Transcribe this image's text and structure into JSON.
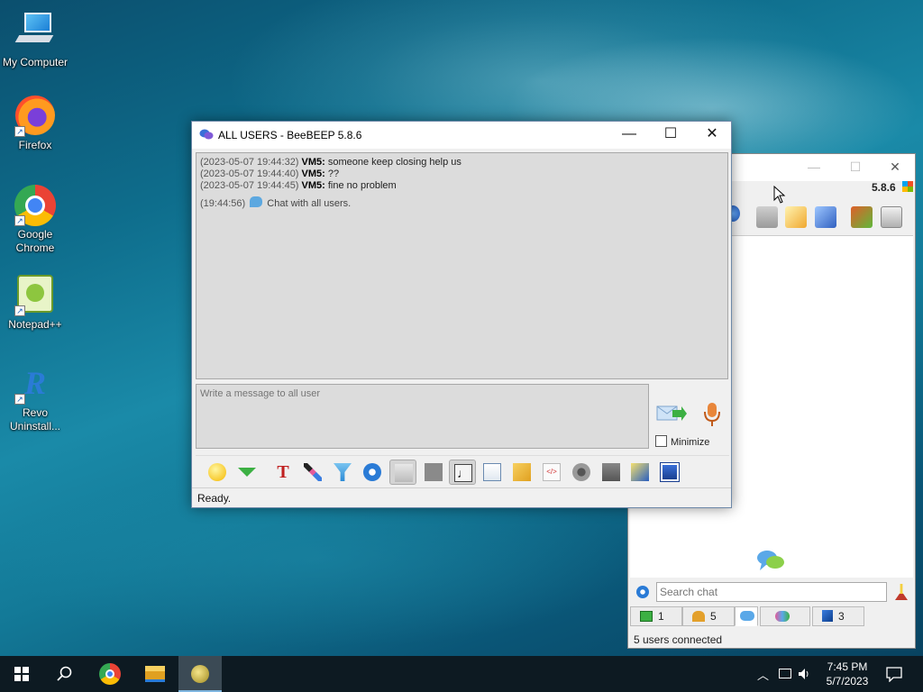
{
  "desktop": {
    "icons": [
      {
        "label": "My Computer"
      },
      {
        "label": "Firefox"
      },
      {
        "label": "Google Chrome"
      },
      {
        "label": "Notepad++"
      },
      {
        "label": "Revo Uninstall..."
      }
    ]
  },
  "main_window": {
    "version": "5.8.6",
    "search_placeholder": "Search chat",
    "tabs": [
      {
        "label": "1"
      },
      {
        "label": "5"
      },
      {
        "label": ""
      },
      {
        "label": ""
      },
      {
        "label": "3"
      }
    ],
    "status": "5 users connected"
  },
  "chat_window": {
    "title": "ALL USERS - BeeBEEP 5.8.6",
    "messages": [
      {
        "ts": "(2023-05-07 19:44:32)",
        "nick": "VM5:",
        "text": "someone keep closing help us"
      },
      {
        "ts": "(2023-05-07 19:44:40)",
        "nick": "VM5:",
        "text": "??"
      },
      {
        "ts": "(2023-05-07 19:44:45)",
        "nick": "VM5:",
        "text": "fine no problem"
      }
    ],
    "system_message": {
      "ts": "(19:44:56)",
      "text": "Chat with all users."
    },
    "composer_placeholder": "Write a message to all user",
    "minimize_label": "Minimize",
    "status": "Ready."
  },
  "taskbar": {
    "clock_time": "7:45 PM",
    "clock_date": "5/7/2023"
  }
}
